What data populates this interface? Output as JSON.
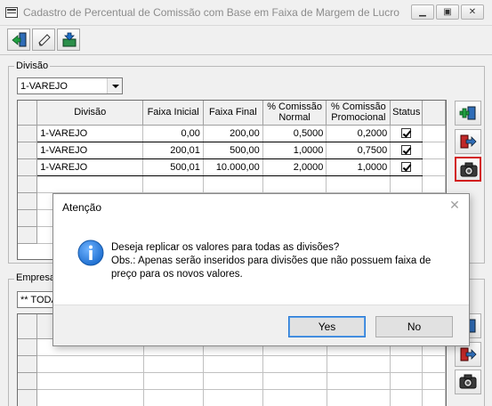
{
  "window": {
    "title": "Cadastro de Percentual de Comissão com Base em Faixa de Margem de Lucro"
  },
  "top_section": {
    "group_label": "Divisão",
    "combo_value": "1-VAREJO",
    "columns": [
      "Divisão",
      "Faixa Inicial",
      "Faixa Final",
      "% Comissão Normal",
      "% Comissão Promocional",
      "Status"
    ],
    "rows": [
      {
        "divisao": "1-VAREJO",
        "faixa_inicial": "0,00",
        "faixa_final": "200,00",
        "comissao_normal": "0,5000",
        "comissao_promocional": "0,2000",
        "status": true
      },
      {
        "divisao": "1-VAREJO",
        "faixa_inicial": "200,01",
        "faixa_final": "500,00",
        "comissao_normal": "1,0000",
        "comissao_promocional": "0,7500",
        "status": true
      },
      {
        "divisao": "1-VAREJO",
        "faixa_inicial": "500,01",
        "faixa_final": "10.000,00",
        "comissao_normal": "2,0000",
        "comissao_promocional": "1,0000",
        "status": true
      }
    ]
  },
  "bottom_section": {
    "group_label": "Empresa",
    "combo_value": "** TODAS"
  },
  "dialog": {
    "title": "Atenção",
    "message_line1": "Deseja replicar os valores para todas as divisões?",
    "message_line2": "Obs.: Apenas serão inseridos para divisões que não possuem faixa de",
    "message_line3": "preço para os novos valores.",
    "yes_label": "Yes",
    "no_label": "No"
  },
  "colors": {
    "selected_button_border": "#d21e1e",
    "info_icon": "#1f6fd0"
  },
  "icons": [
    "exit-icon",
    "edit-icon",
    "save-icon",
    "add-record-icon",
    "remove-record-icon",
    "camera-icon",
    "info-icon"
  ]
}
